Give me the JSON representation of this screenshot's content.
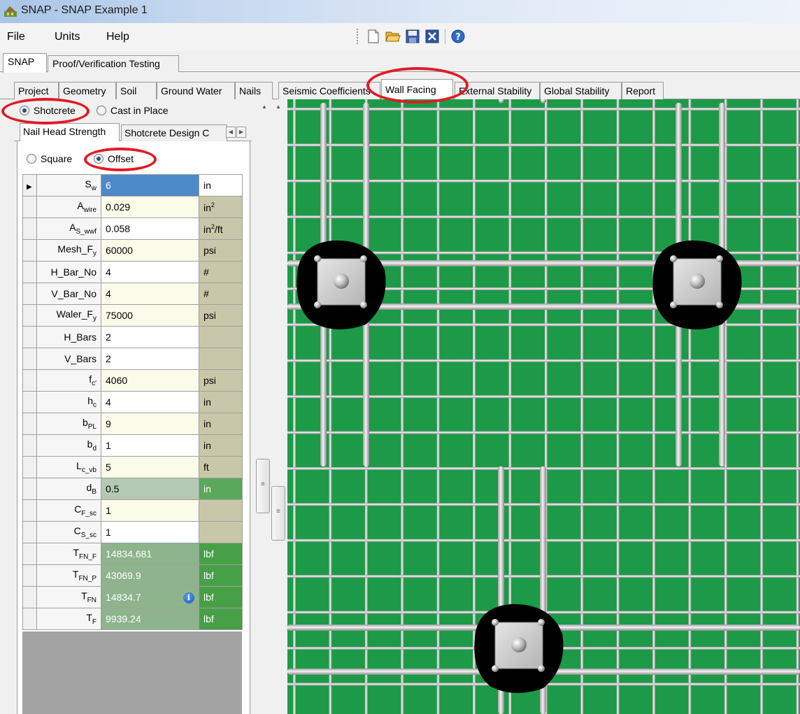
{
  "window": {
    "title": "SNAP - SNAP Example 1"
  },
  "menu": {
    "file": "File",
    "units": "Units",
    "help": "Help"
  },
  "toolbar": [
    "new-file-icon",
    "open-folder-icon",
    "save-icon",
    "export-icon",
    "help-icon"
  ],
  "top_tabs": {
    "snap": "SNAP",
    "proof": "Proof/Verification Testing"
  },
  "inner_tabs": {
    "project": "Project",
    "geometry": "Geometry",
    "soil": "Soil",
    "ground_water": "Ground Water",
    "nails": "Nails",
    "seismic": "Seismic Coefficients",
    "wall_facing": "Wall Facing",
    "external": "External Stability",
    "global": "Global Stability",
    "report": "Report"
  },
  "facing_type": {
    "shotcrete": "Shotcrete",
    "cast_in_place": "Cast in Place",
    "selected": "Shotcrete"
  },
  "sub_tabs": {
    "nail_head": "Nail Head Strength",
    "shotcrete_design": "Shotcrete Design C"
  },
  "pattern": {
    "square": "Square",
    "offset": "Offset",
    "selected": "Offset"
  },
  "grid_rows": [
    {
      "base": "S",
      "sub": "w",
      "value": "6",
      "unit": "in"
    },
    {
      "base": "A",
      "sub": "wire",
      "value": "0.029",
      "unit": "in",
      "unit_sup": "2"
    },
    {
      "base": "A",
      "sub": "S_wwf",
      "value": "0.058",
      "unit": "in",
      "unit_sup": "2",
      "unit_tail": "/ft"
    },
    {
      "base": "Mesh_F",
      "sub": "y",
      "value": "60000",
      "unit": "psi"
    },
    {
      "base": "H_Bar_No",
      "sub": "",
      "value": "4",
      "unit": "#"
    },
    {
      "base": "V_Bar_No",
      "sub": "",
      "value": "4",
      "unit": "#"
    },
    {
      "base": "Waler_F",
      "sub": "y",
      "value": "75000",
      "unit": "psi"
    },
    {
      "base": "H_Bars",
      "sub": "",
      "value": "2",
      "unit": ""
    },
    {
      "base": "V_Bars",
      "sub": "",
      "value": "2",
      "unit": ""
    },
    {
      "base": "f",
      "sub": "c'",
      "value": "4060",
      "unit": "psi"
    },
    {
      "base": "h",
      "sub": "c",
      "value": "4",
      "unit": "in"
    },
    {
      "base": "b",
      "sub": "PL",
      "value": "9",
      "unit": "in"
    },
    {
      "base": "b",
      "sub": "d",
      "value": "1",
      "unit": "in"
    },
    {
      "base": "L",
      "sub": "c_vb",
      "value": "5",
      "unit": "ft"
    },
    {
      "base": "d",
      "sub": "B",
      "value": "0.5",
      "unit": "in"
    },
    {
      "base": "C",
      "sub": "F_sc",
      "value": "1",
      "unit": ""
    },
    {
      "base": "C",
      "sub": "S_sc",
      "value": "1",
      "unit": ""
    },
    {
      "base": "T",
      "sub": "FN_F",
      "value": "14834.681",
      "unit": "lbf"
    },
    {
      "base": "T",
      "sub": "FN_P",
      "value": "43069.9",
      "unit": "lbf"
    },
    {
      "base": "T",
      "sub": "FN",
      "value": "14834.7",
      "unit": "lbf",
      "info": true
    },
    {
      "base": "T",
      "sub": "F",
      "value": "9939.24",
      "unit": "lbf"
    }
  ],
  "colors": {
    "canvas_green": "#1c9a48",
    "annotation_red": "#e01b24",
    "selected_cell": "#4c89c9"
  }
}
